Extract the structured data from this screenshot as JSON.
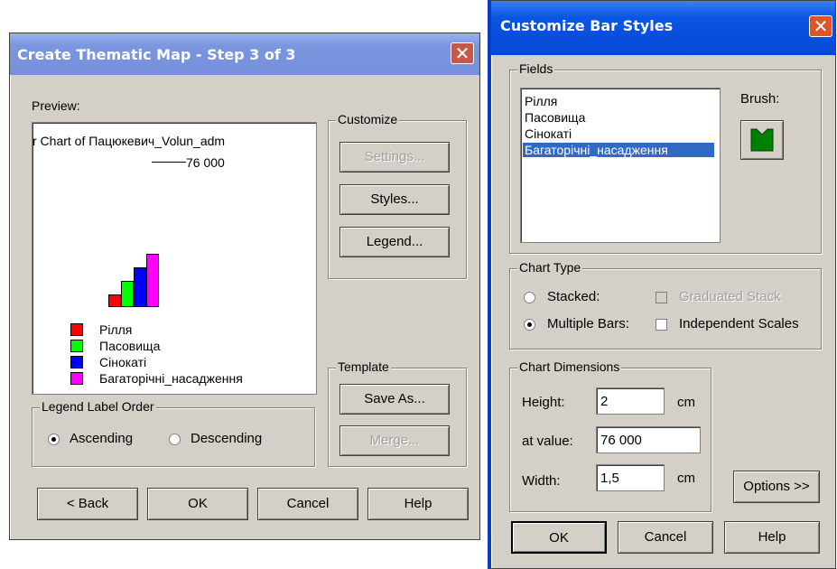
{
  "left_dialog": {
    "title": "Create Thematic Map - Step 3 of 3",
    "close_glyph": "✕",
    "preview_label": "Preview:",
    "preview_title": "r Chart of Пацюкевич_Volun_adm",
    "preview_value": "76 000",
    "legend": [
      {
        "label": "Рілля",
        "color": "#ff0000"
      },
      {
        "label": "Пасовища",
        "color": "#00ff00"
      },
      {
        "label": "Сінокаті",
        "color": "#0000ff"
      },
      {
        "label": "Багаторічні_насадження",
        "color": "#ff00ff"
      }
    ],
    "customize": {
      "title": "Customize",
      "settings": "Settings...",
      "styles": "Styles...",
      "legend": "Legend..."
    },
    "template": {
      "title": "Template",
      "save_as": "Save As...",
      "merge": "Merge..."
    },
    "label_order": {
      "title": "Legend Label Order",
      "ascending": "Ascending",
      "descending": "Descending",
      "selected": "Ascending"
    },
    "buttons": {
      "back": "< Back",
      "ok": "OK",
      "cancel": "Cancel",
      "help": "Help"
    }
  },
  "right_dialog": {
    "title": "Customize Bar Styles",
    "close_glyph": "✕",
    "fields": {
      "title": "Fields",
      "items": [
        "Рілля",
        "Пасовища",
        "Сінокаті",
        "Багаторічні_насадження"
      ],
      "selected_index": 3,
      "brush_label": "Brush:",
      "brush_color": "#008000"
    },
    "chart_type": {
      "title": "Chart Type",
      "stacked": "Stacked:",
      "multiple_bars": "Multiple Bars:",
      "selected": "Multiple Bars",
      "graduated_stack": "Graduated Stack",
      "independent_scales": "Independent Scales"
    },
    "dimensions": {
      "title": "Chart Dimensions",
      "height_label": "Height:",
      "height_value": "2",
      "height_unit": "cm",
      "at_value_label": "at value:",
      "at_value": "76 000",
      "width_label": "Width:",
      "width_value": "1,5",
      "width_unit": "cm"
    },
    "buttons": {
      "options": "Options >>",
      "ok": "OK",
      "cancel": "Cancel",
      "help": "Help"
    }
  },
  "colors": {
    "left_title_bg": "#7a96df",
    "right_title_bg": "#0a55e3",
    "selection": "#316ac5"
  }
}
